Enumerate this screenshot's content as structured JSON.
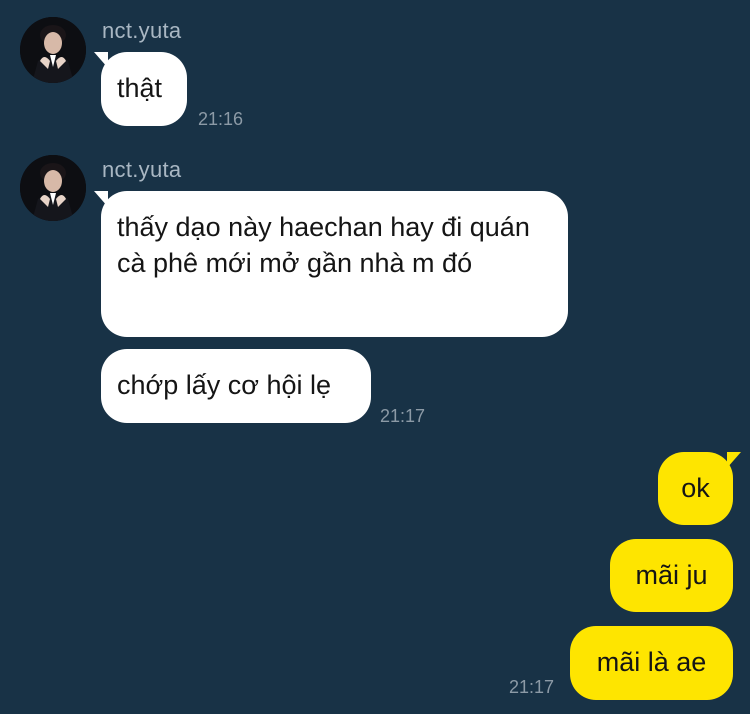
{
  "colors": {
    "background": "#183246",
    "incoming_bubble": "#ffffff",
    "outgoing_bubble": "#fee500",
    "sender_name": "#a9b7c3",
    "timestamp": "#8c9aa6"
  },
  "messages": [
    {
      "sender": "nct.yuta",
      "avatar_icon": "profile-photo",
      "bubbles": [
        "thật"
      ],
      "time": "21:16"
    },
    {
      "sender": "nct.yuta",
      "avatar_icon": "profile-photo",
      "bubbles": [
        "thấy dạo này haechan hay đi quán cà phê mới mở gần nhà m đó",
        "chớp lấy cơ hội lẹ"
      ],
      "time": "21:17"
    }
  ],
  "outgoing": {
    "bubbles": [
      "ok",
      "mãi ju",
      "mãi là ae"
    ],
    "time": "21:17"
  }
}
